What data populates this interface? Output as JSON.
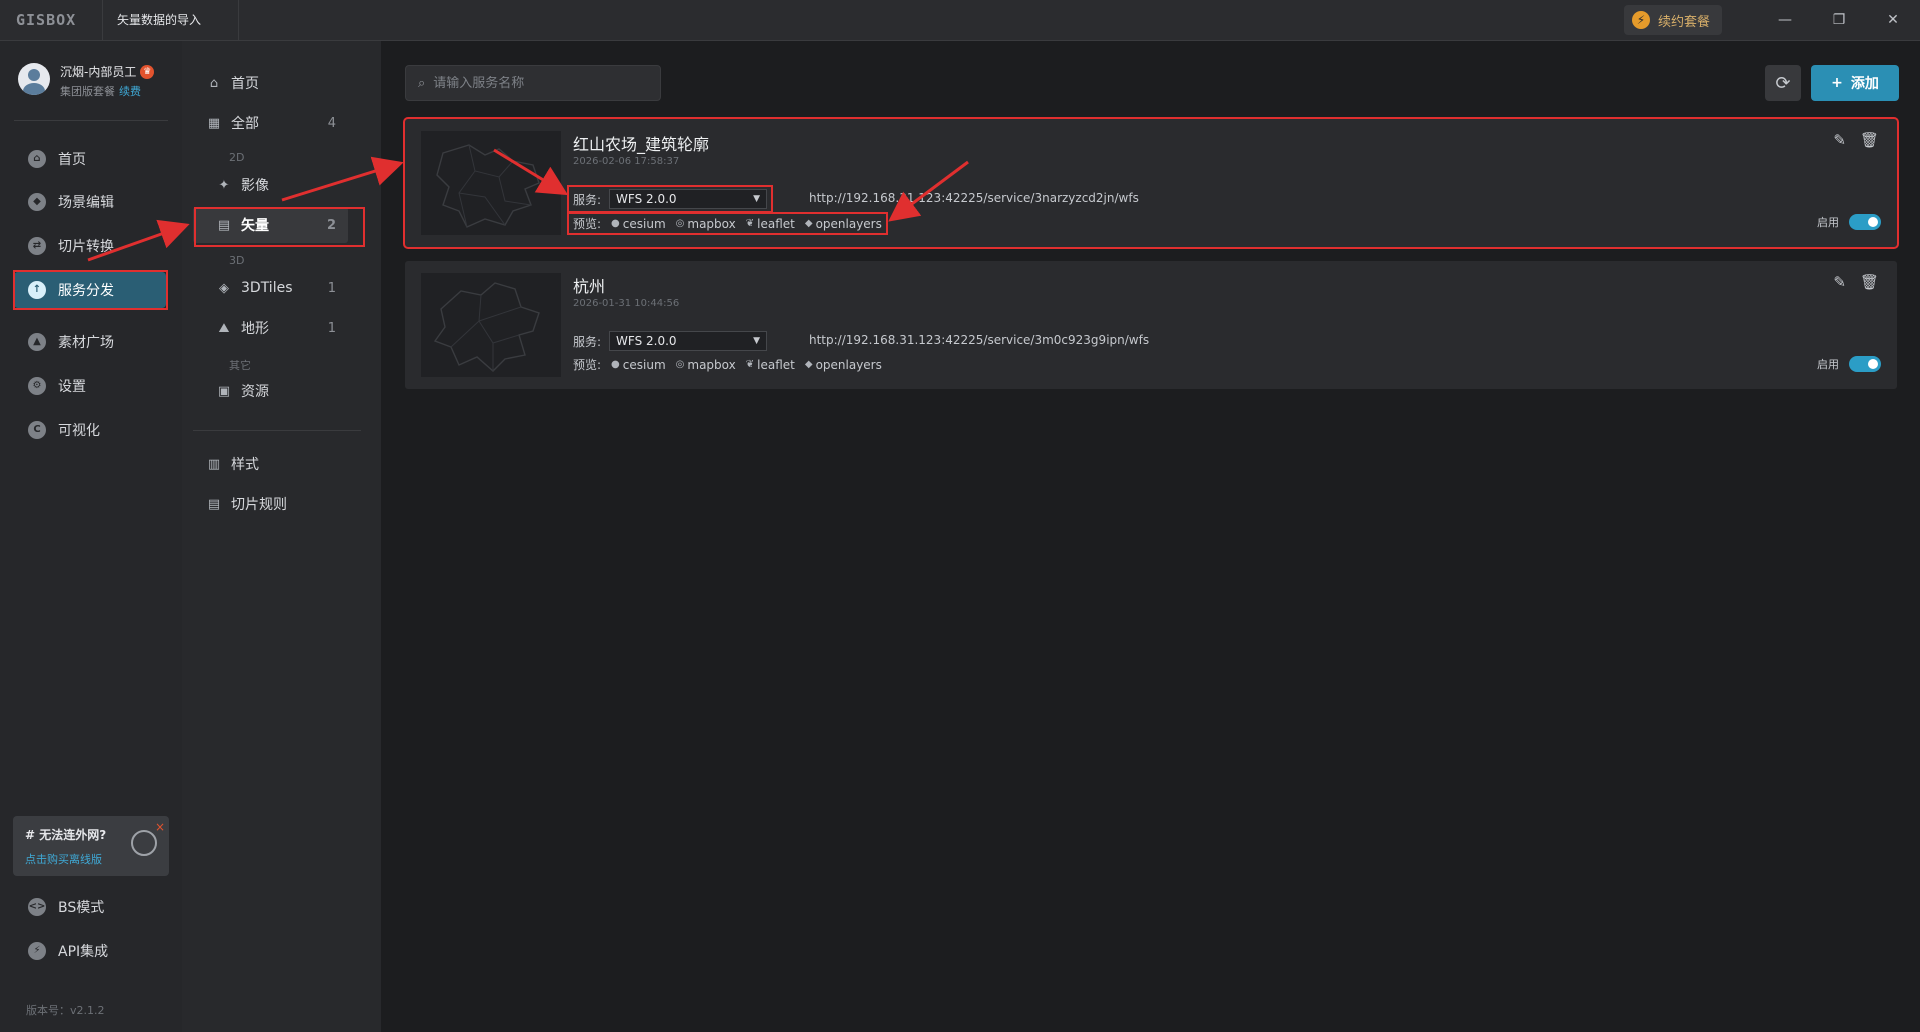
{
  "titlebar": {
    "logo": "GISBOX",
    "window_title": "矢量数据的导入",
    "renew_label": "续约套餐",
    "minimize": "—",
    "maximize": "❐",
    "close": "✕"
  },
  "user": {
    "name": "沉烟-内部员工",
    "plan": "集团版套餐",
    "renew": "续费"
  },
  "nav": {
    "items": [
      {
        "label": "首页",
        "icon": "home-icon"
      },
      {
        "label": "场景编辑",
        "icon": "cube-icon"
      },
      {
        "label": "切片转换",
        "icon": "swap-icon"
      },
      {
        "label": "服务分发",
        "icon": "upload-icon",
        "active": true
      },
      {
        "label": "素材广场",
        "icon": "image-icon"
      },
      {
        "label": "设置",
        "icon": "gear-icon"
      },
      {
        "label": "可视化",
        "icon": "chart-icon"
      }
    ],
    "bottom_items": [
      {
        "label": "BS模式",
        "icon": "code-icon"
      },
      {
        "label": "API集成",
        "icon": "plug-icon"
      }
    ],
    "offline_title": "# 无法连外网?",
    "offline_link": "点击购买离线版",
    "version": "版本号：v2.1.2"
  },
  "subnav": {
    "home": "首页",
    "all": {
      "label": "全部",
      "count": "4"
    },
    "group_2d": "2D",
    "imagery": {
      "label": "影像"
    },
    "vector": {
      "label": "矢量",
      "count": "2"
    },
    "group_3d": "3D",
    "tiles3d": {
      "label": "3DTiles",
      "count": "1"
    },
    "terrain": {
      "label": "地形",
      "count": "1"
    },
    "group_other": "其它",
    "resource": {
      "label": "资源"
    },
    "style": "样式",
    "tile_rules": "切片规则"
  },
  "main": {
    "search_placeholder": "请输入服务名称",
    "add_label": "添加",
    "cards": [
      {
        "title": "红山农场_建筑轮廓",
        "date": "2026-02-06 17:58:37",
        "service_label": "服务:",
        "service_value": "WFS 2.0.0",
        "url": "http://192.168.31.123:42225/service/3narzyzcd2jn/wfs",
        "preview_label": "预览:",
        "previews": [
          "cesium",
          "mapbox",
          "leaflet",
          "openlayers"
        ],
        "enable_label": "启用",
        "enabled": true
      },
      {
        "title": "杭州",
        "date": "2026-01-31 10:44:56",
        "service_label": "服务:",
        "service_value": "WFS 2.0.0",
        "url": "http://192.168.31.123:42225/service/3m0c923g9ipn/wfs",
        "preview_label": "预览:",
        "previews": [
          "cesium",
          "mapbox",
          "leaflet",
          "openlayers"
        ],
        "enable_label": "启用",
        "enabled": true
      }
    ]
  },
  "colors": {
    "accent": "#2b8fb4",
    "active_nav": "#2a5e74",
    "annotation": "#e02f2f"
  }
}
